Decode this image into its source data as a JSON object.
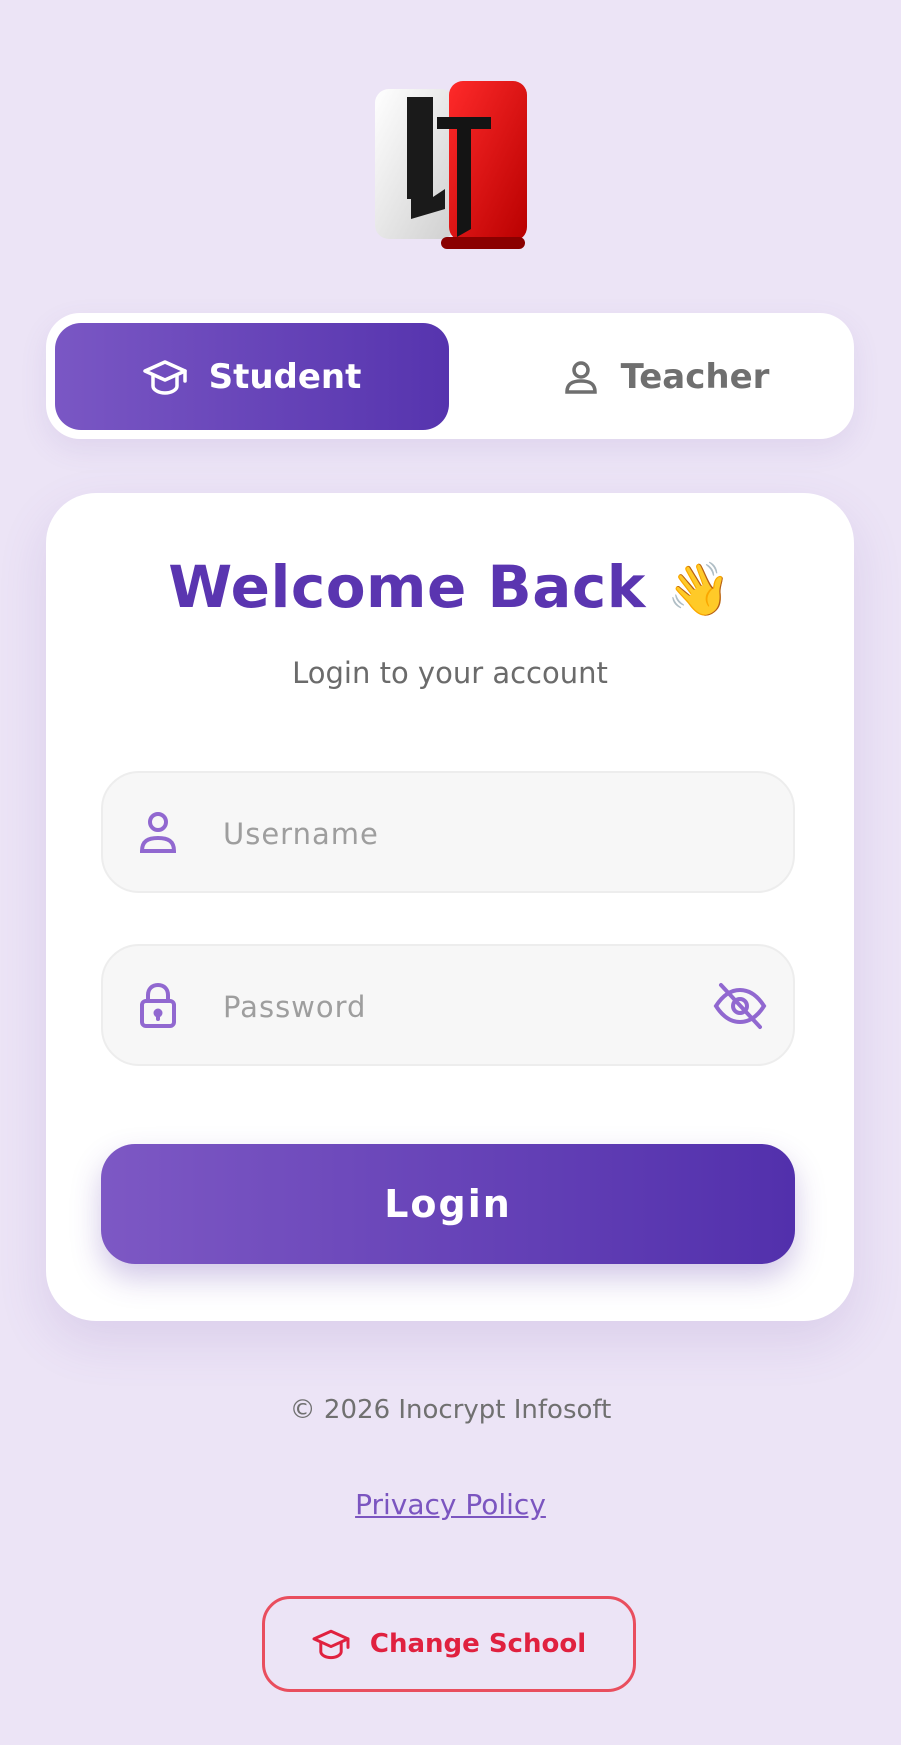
{
  "roles": {
    "student_label": "Student",
    "teacher_label": "Teacher",
    "active": "Student"
  },
  "login": {
    "title": "Welcome Back",
    "wave_emoji": "👋",
    "subtitle": "Login to your account",
    "username_placeholder": "Username",
    "username_value": "",
    "password_placeholder": "Password",
    "password_value": "",
    "button_label": "Login"
  },
  "footer": {
    "copyright": "© 2026 Inocrypt Infosoft",
    "privacy_label": "Privacy Policy",
    "change_school_label": "Change School"
  },
  "icons": {
    "student_tab": "graduation-cap-icon",
    "teacher_tab": "user-icon",
    "username": "user-icon",
    "password": "lock-icon",
    "toggle_password": "eye-off-icon",
    "change_school": "graduation-cap-icon"
  },
  "colors": {
    "background": "#ECE4F6",
    "primary": "#5A35B0",
    "primary_light": "#7D58C4",
    "danger": "#E0213F",
    "logo_red": "#E00010"
  }
}
